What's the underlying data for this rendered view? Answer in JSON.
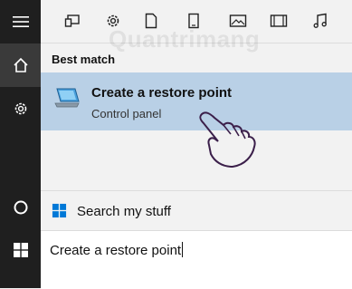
{
  "rail": {
    "items": [
      {
        "icon": "hamburger-menu-icon"
      },
      {
        "icon": "home-icon"
      },
      {
        "icon": "gear-icon"
      },
      {
        "icon": "cortana-circle-icon"
      },
      {
        "icon": "windows-logo-icon"
      }
    ]
  },
  "filters": [
    "apps-icon",
    "settings-icon",
    "documents-icon",
    "tablet-icon",
    "photos-icon",
    "videos-icon",
    "music-icon"
  ],
  "watermark": "Quantrimang",
  "best_match": {
    "heading": "Best match",
    "title": "Create a restore point",
    "subtitle": "Control panel"
  },
  "search_stuff": {
    "label": "Search my stuff"
  },
  "search_input": {
    "value": "Create a restore point"
  },
  "colors": {
    "rail_bg": "#1f1f1f",
    "panel_bg": "#f2f2f2",
    "selected_bg": "#b9d0e6",
    "accent": "#0078d7"
  }
}
